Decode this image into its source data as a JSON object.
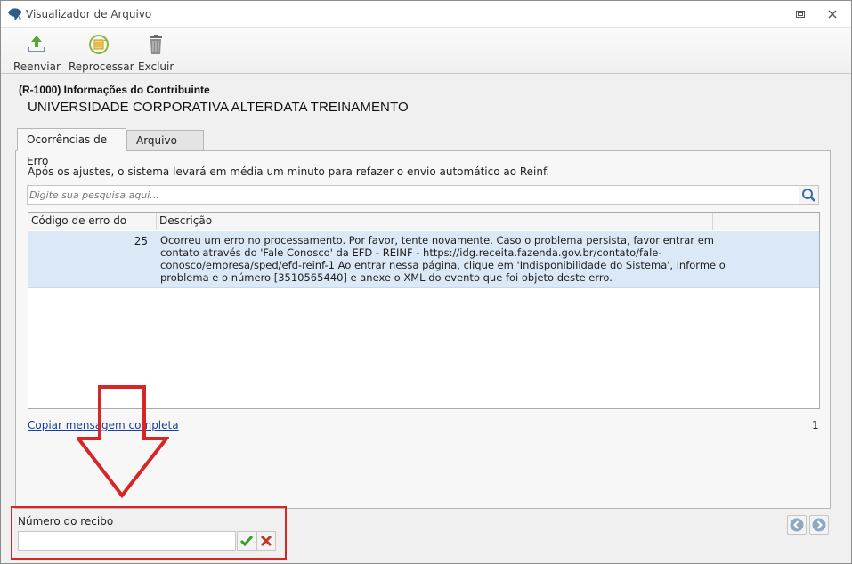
{
  "window": {
    "title": "Visualizador de Arquivo",
    "restore_icon": "restore-icon",
    "close_icon": "close-icon"
  },
  "toolbar": {
    "buttons": [
      {
        "label": "Reenviar",
        "icon": "upload-icon"
      },
      {
        "label": "Reprocessar",
        "icon": "reprocess-icon"
      },
      {
        "label": "Excluir",
        "icon": "trash-icon"
      }
    ]
  },
  "header": {
    "event_title": "(R-1000) Informações do Contribuinte",
    "company_name": "UNIVERSIDADE CORPORATIVA ALTERDATA TREINAMENTO"
  },
  "tabs": [
    {
      "label": "Ocorrências de Erro",
      "active": true
    },
    {
      "label": "Arquivo XML",
      "active": false
    }
  ],
  "errors_tab": {
    "info_text": "Após os ajustes, o sistema levará em média um minuto para refazer o envio automático ao Reinf.",
    "search_placeholder": "Digite sua pesquisa aqui...",
    "columns": [
      "Código de erro do Reinf",
      "Descrição",
      ""
    ],
    "rows": [
      {
        "code": "25",
        "description": "Ocorreu um erro no processamento. Por favor, tente novamente. Caso o problema persista, favor entrar em\ncontato através do 'Fale Conosco' da EFD - REINF - https://idg.receita.fazenda.gov.br/contato/fale-\nconosco/empresa/sped/efd-reinf-1 Ao entrar nessa página, clique em 'Indisponibilidade do Sistema', informe o\nproblema e o número [3510565440] e anexe o XML do evento que foi objeto deste erro."
      }
    ],
    "copy_link": "Copiar mensagem completa",
    "record_count": "1"
  },
  "receipt": {
    "label": "Número do recibo",
    "value": ""
  },
  "colors": {
    "selected_row": "#dbe9f7",
    "link": "#1a3e9e",
    "annotation": "#d62626",
    "confirm": "#3a9a2a",
    "cancel": "#c0392b"
  }
}
